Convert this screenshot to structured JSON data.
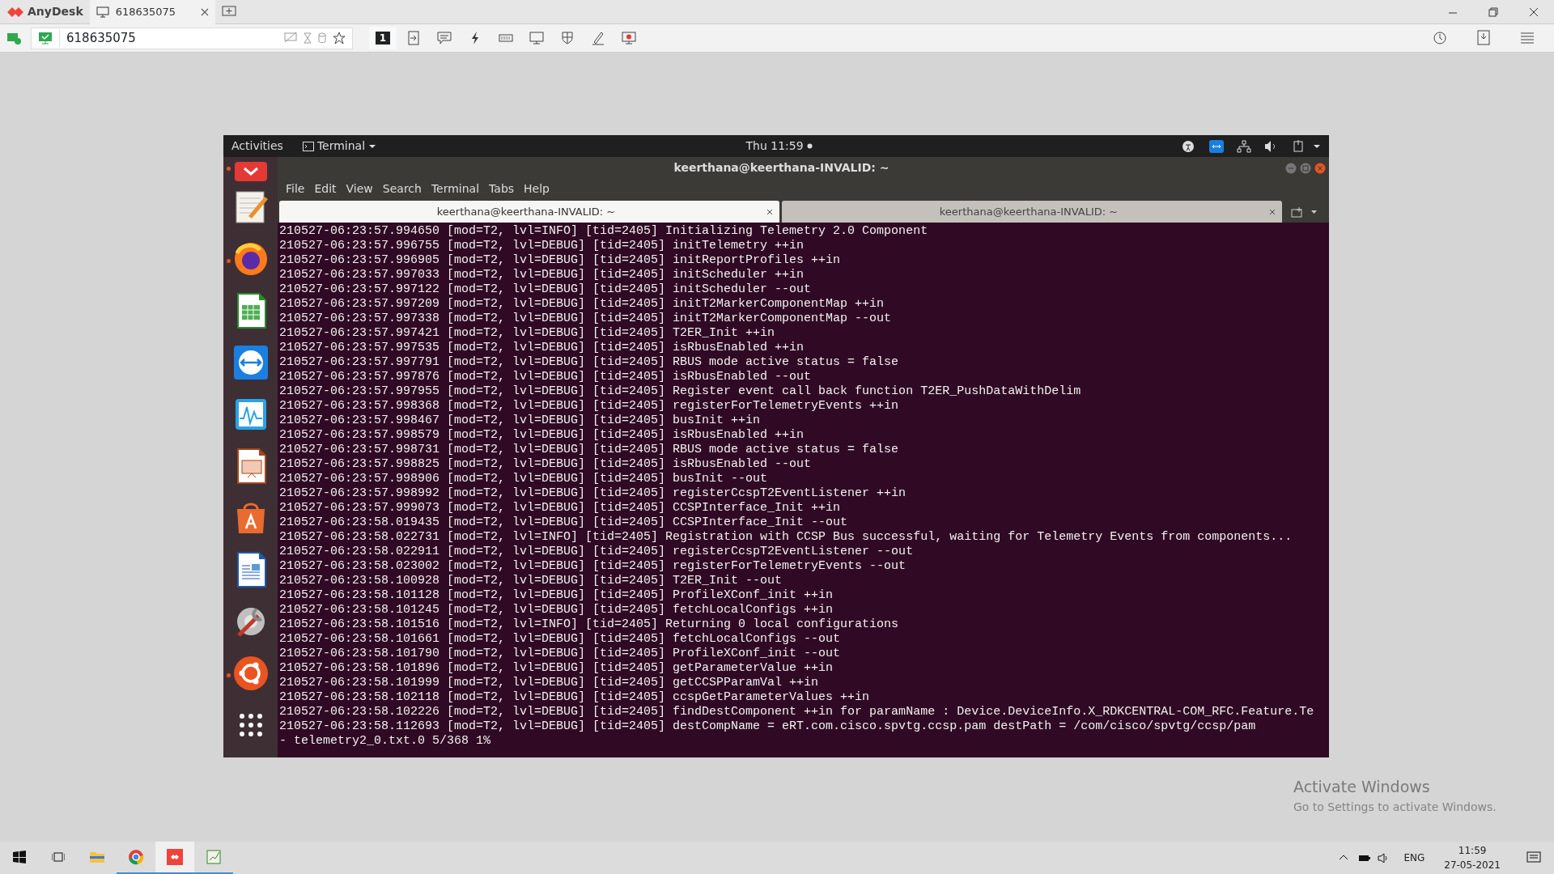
{
  "anydesk": {
    "app_name": "AnyDesk",
    "tab": {
      "label": "618635075"
    },
    "address": "618635075",
    "display_number": "1"
  },
  "remote": {
    "top_bar": {
      "activities": "Activities",
      "app_menu": "Terminal",
      "clock": "Thu 11:59"
    },
    "dock": [
      {
        "kind": "anydesk",
        "running": true
      },
      {
        "kind": "notes",
        "running": false
      },
      {
        "kind": "firefox",
        "running": true
      },
      {
        "kind": "calc",
        "running": false
      },
      {
        "kind": "remote",
        "running": false
      },
      {
        "kind": "monitor",
        "running": false
      },
      {
        "kind": "impress",
        "running": false
      },
      {
        "kind": "store",
        "running": false
      },
      {
        "kind": "writer",
        "running": false
      },
      {
        "kind": "tools",
        "running": false
      },
      {
        "kind": "ubuntu",
        "running": true
      },
      {
        "kind": "grid",
        "running": false
      }
    ],
    "terminal": {
      "title": "keerthana@keerthana-INVALID: ~",
      "menu": [
        "File",
        "Edit",
        "View",
        "Search",
        "Terminal",
        "Tabs",
        "Help"
      ],
      "tabs": [
        {
          "label": "keerthana@keerthana-INVALID: ~",
          "selected": true
        },
        {
          "label": "keerthana@keerthana-INVALID: ~",
          "selected": false
        }
      ],
      "lines": [
        "210527-06:23:57.994650 [mod=T2, lvl=INFO] [tid=2405] Initializing Telemetry 2.0 Component",
        "210527-06:23:57.996755 [mod=T2, lvl=DEBUG] [tid=2405] initTelemetry ++in",
        "210527-06:23:57.996905 [mod=T2, lvl=DEBUG] [tid=2405] initReportProfiles ++in",
        "210527-06:23:57.997033 [mod=T2, lvl=DEBUG] [tid=2405] initScheduler ++in",
        "210527-06:23:57.997122 [mod=T2, lvl=DEBUG] [tid=2405] initScheduler --out",
        "210527-06:23:57.997209 [mod=T2, lvl=DEBUG] [tid=2405] initT2MarkerComponentMap ++in",
        "210527-06:23:57.997338 [mod=T2, lvl=DEBUG] [tid=2405] initT2MarkerComponentMap --out",
        "210527-06:23:57.997421 [mod=T2, lvl=DEBUG] [tid=2405] T2ER_Init ++in",
        "210527-06:23:57.997535 [mod=T2, lvl=DEBUG] [tid=2405] isRbusEnabled ++in",
        "210527-06:23:57.997791 [mod=T2, lvl=DEBUG] [tid=2405] RBUS mode active status = false",
        "210527-06:23:57.997876 [mod=T2, lvl=DEBUG] [tid=2405] isRbusEnabled --out",
        "210527-06:23:57.997955 [mod=T2, lvl=DEBUG] [tid=2405] Register event call back function T2ER_PushDataWithDelim",
        "210527-06:23:57.998368 [mod=T2, lvl=DEBUG] [tid=2405] registerForTelemetryEvents ++in",
        "210527-06:23:57.998467 [mod=T2, lvl=DEBUG] [tid=2405] busInit ++in",
        "210527-06:23:57.998579 [mod=T2, lvl=DEBUG] [tid=2405] isRbusEnabled ++in",
        "210527-06:23:57.998731 [mod=T2, lvl=DEBUG] [tid=2405] RBUS mode active status = false",
        "210527-06:23:57.998825 [mod=T2, lvl=DEBUG] [tid=2405] isRbusEnabled --out",
        "210527-06:23:57.998906 [mod=T2, lvl=DEBUG] [tid=2405] busInit --out",
        "210527-06:23:57.998992 [mod=T2, lvl=DEBUG] [tid=2405] registerCcspT2EventListener ++in",
        "210527-06:23:57.999073 [mod=T2, lvl=DEBUG] [tid=2405] CCSPInterface_Init ++in",
        "210527-06:23:58.019435 [mod=T2, lvl=DEBUG] [tid=2405] CCSPInterface_Init --out",
        "210527-06:23:58.022731 [mod=T2, lvl=INFO] [tid=2405] Registration with CCSP Bus successful, waiting for Telemetry Events from components...",
        "210527-06:23:58.022911 [mod=T2, lvl=DEBUG] [tid=2405] registerCcspT2EventListener --out",
        "210527-06:23:58.023002 [mod=T2, lvl=DEBUG] [tid=2405] registerForTelemetryEvents --out",
        "210527-06:23:58.100928 [mod=T2, lvl=DEBUG] [tid=2405] T2ER_Init --out",
        "210527-06:23:58.101128 [mod=T2, lvl=DEBUG] [tid=2405] ProfileXConf_init ++in",
        "210527-06:23:58.101245 [mod=T2, lvl=DEBUG] [tid=2405] fetchLocalConfigs ++in",
        "210527-06:23:58.101516 [mod=T2, lvl=INFO] [tid=2405] Returning 0 local configurations",
        "210527-06:23:58.101661 [mod=T2, lvl=DEBUG] [tid=2405] fetchLocalConfigs --out",
        "210527-06:23:58.101790 [mod=T2, lvl=DEBUG] [tid=2405] ProfileXConf_init --out",
        "210527-06:23:58.101896 [mod=T2, lvl=DEBUG] [tid=2405] getParameterValue ++in",
        "210527-06:23:58.101999 [mod=T2, lvl=DEBUG] [tid=2405] getCCSPParamVal ++in",
        "210527-06:23:58.102118 [mod=T2, lvl=DEBUG] [tid=2405] ccspGetParameterValues ++in",
        "210527-06:23:58.102226 [mod=T2, lvl=DEBUG] [tid=2405] findDestComponent ++in for paramName : Device.DeviceInfo.X_RDKCENTRAL-COM_RFC.Feature.Te",
        "210527-06:23:58.112693 [mod=T2, lvl=DEBUG] [tid=2405] destCompName = eRT.com.cisco.spvtg.ccsp.pam destPath = /com/cisco/spvtg/ccsp/pam",
        "- telemetry2_0.txt.0 5/368 1%"
      ]
    }
  },
  "activation": {
    "title": "Activate Windows",
    "subtitle": "Go to Settings to activate Windows."
  },
  "taskbar": {
    "apps": [
      {
        "kind": "explorer",
        "running": false,
        "selected": false
      },
      {
        "kind": "chrome",
        "running": true,
        "selected": false
      },
      {
        "kind": "anydesk",
        "running": true,
        "selected": true
      },
      {
        "kind": "editor",
        "running": true,
        "selected": false
      }
    ],
    "language": "ENG",
    "time": "11:59",
    "date": "27-05-2021"
  }
}
